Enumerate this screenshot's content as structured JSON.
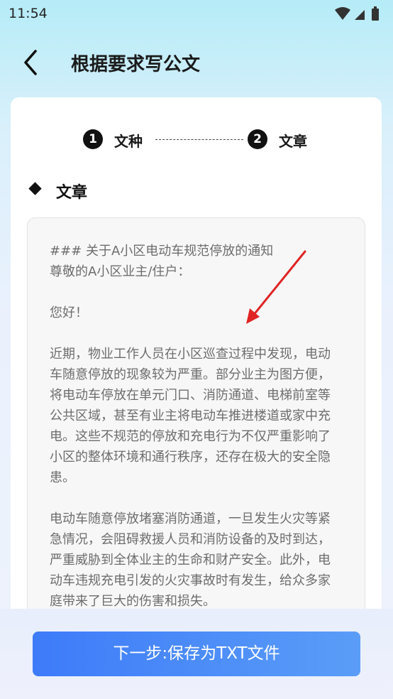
{
  "status_bar": {
    "time": "11:54",
    "icons": [
      "wifi-icon",
      "signal-icon",
      "battery-icon"
    ]
  },
  "header": {
    "back_icon": "arrow-left-icon",
    "title": "根据要求写公文"
  },
  "steps": [
    {
      "number": "1",
      "label": "文种",
      "icon": "number-1-icon"
    },
    {
      "number": "2",
      "label": "文章",
      "icon": "number-2-icon"
    }
  ],
  "section": {
    "icon": "diamond-bullet-icon",
    "title": "文章"
  },
  "article": {
    "text": "### 关于A小区电动车规范停放的通知\n尊敬的A小区业主/住户：\n\n您好！\n\n近期，物业工作人员在小区巡查过程中发现，电动车随意停放的现象较为严重。部分业主为图方便，将电动车停放在单元门口、消防通道、电梯前室等公共区域，甚至有业主将电动车推进楼道或家中充电。这些不规范的停放和充电行为不仅严重影响了小区的整体环境和通行秩序，还存在极大的安全隐患。\n\n电动车随意停放堵塞消防通道，一旦发生火灾等紧急情况，会阻碍救援人员和消防设备的及时到达，严重威胁到全体业主的生命和财产安全。此外，电动车违规充电引发的火灾事故时有发生，给众多家庭带来了巨大的伤害和损失。"
  },
  "annotation": {
    "arrow_color": "#e02424"
  },
  "footer": {
    "next_button_label": "下一步:保存为TXT文件"
  },
  "colors": {
    "button_gradient_start": "#3d7bf9",
    "button_gradient_end": "#5a9df7",
    "article_text": "#6d6d6d"
  }
}
